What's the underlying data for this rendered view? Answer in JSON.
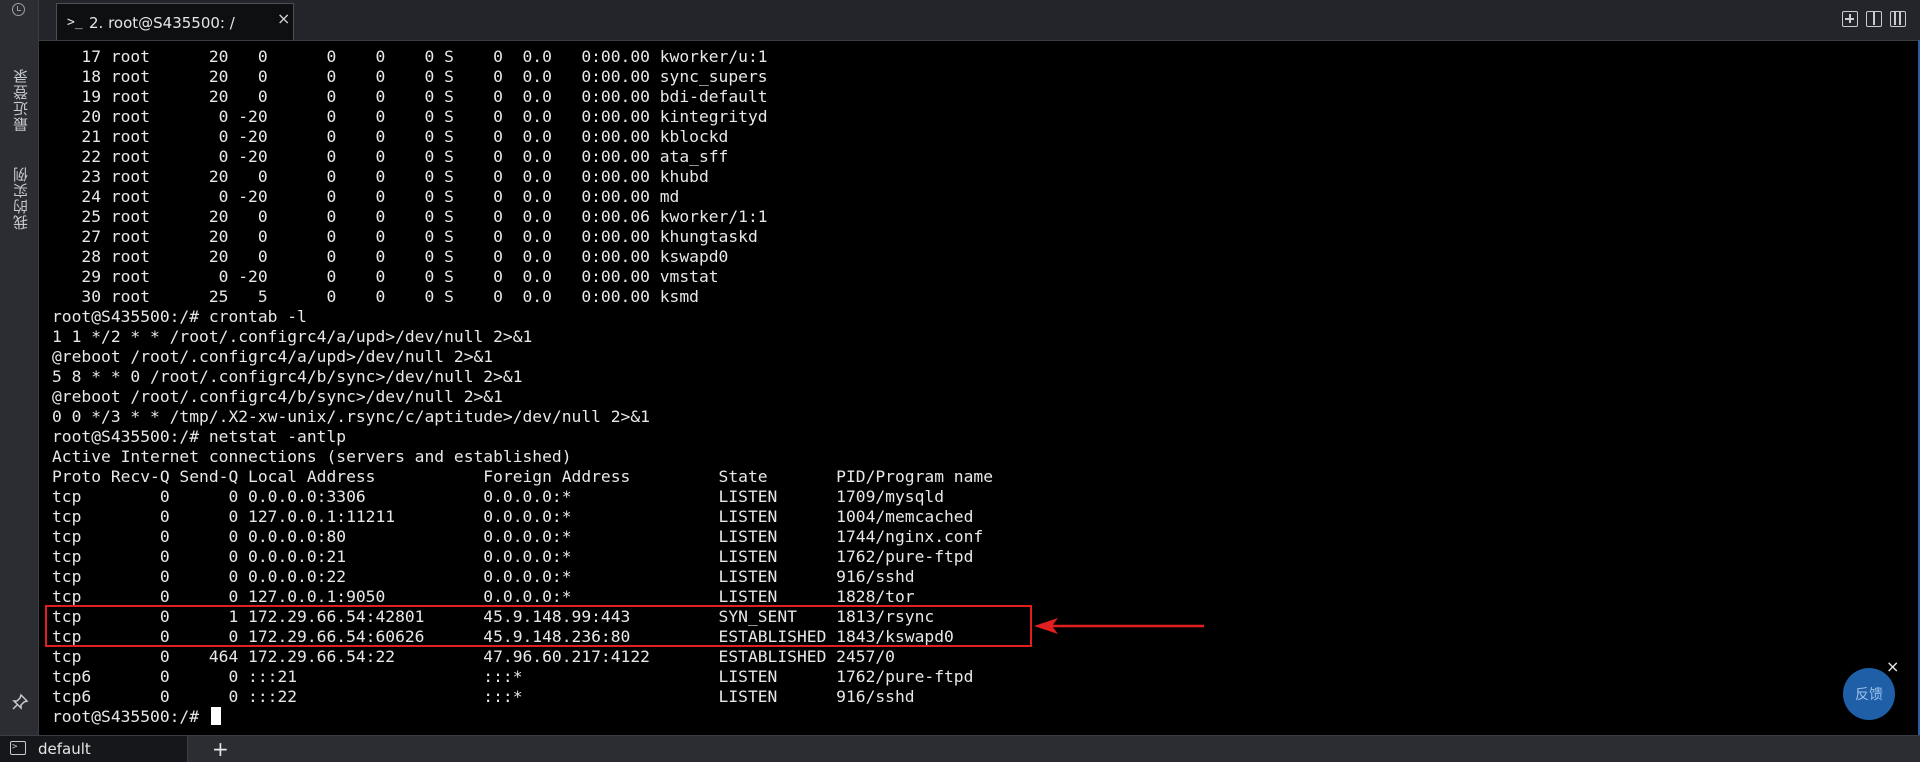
{
  "sidebar": {
    "recent_label": "最近登录",
    "mine_label": "我的实例"
  },
  "tab": {
    "prompt_icon": ">_",
    "title": "2. root@S435500: /",
    "close": "×"
  },
  "terminal": {
    "lines": [
      "   17 root      20   0      0    0    0 S    0  0.0   0:00.00 kworker/u:1",
      "   18 root      20   0      0    0    0 S    0  0.0   0:00.00 sync_supers",
      "   19 root      20   0      0    0    0 S    0  0.0   0:00.00 bdi-default",
      "   20 root       0 -20      0    0    0 S    0  0.0   0:00.00 kintegrityd",
      "   21 root       0 -20      0    0    0 S    0  0.0   0:00.00 kblockd",
      "   22 root       0 -20      0    0    0 S    0  0.0   0:00.00 ata_sff",
      "   23 root      20   0      0    0    0 S    0  0.0   0:00.00 khubd",
      "   24 root       0 -20      0    0    0 S    0  0.0   0:00.00 md",
      "   25 root      20   0      0    0    0 S    0  0.0   0:00.06 kworker/1:1",
      "   27 root      20   0      0    0    0 S    0  0.0   0:00.00 khungtaskd",
      "   28 root      20   0      0    0    0 S    0  0.0   0:00.00 kswapd0",
      "   29 root       0 -20      0    0    0 S    0  0.0   0:00.00 vmstat",
      "   30 root      25   5      0    0    0 S    0  0.0   0:00.00 ksmd",
      "root@S435500:/# crontab -l",
      "1 1 */2 * * /root/.configrc4/a/upd>/dev/null 2>&1",
      "@reboot /root/.configrc4/a/upd>/dev/null 2>&1",
      "5 8 * * 0 /root/.configrc4/b/sync>/dev/null 2>&1",
      "@reboot /root/.configrc4/b/sync>/dev/null 2>&1",
      "0 0 */3 * * /tmp/.X2-xw-unix/.rsync/c/aptitude>/dev/null 2>&1",
      "root@S435500:/# netstat -antlp",
      "Active Internet connections (servers and established)",
      "Proto Recv-Q Send-Q Local Address           Foreign Address         State       PID/Program name",
      "tcp        0      0 0.0.0.0:3306            0.0.0.0:*               LISTEN      1709/mysqld",
      "tcp        0      0 127.0.0.1:11211         0.0.0.0:*               LISTEN      1004/memcached",
      "tcp        0      0 0.0.0.0:80              0.0.0.0:*               LISTEN      1744/nginx.conf",
      "tcp        0      0 0.0.0.0:21              0.0.0.0:*               LISTEN      1762/pure-ftpd",
      "tcp        0      0 0.0.0.0:22              0.0.0.0:*               LISTEN      916/sshd",
      "tcp        0      0 127.0.0.1:9050          0.0.0.0:*               LISTEN      1828/tor",
      "tcp        0      1 172.29.66.54:42801      45.9.148.99:443         SYN_SENT    1813/rsync",
      "tcp        0      0 172.29.66.54:60626      45.9.148.236:80         ESTABLISHED 1843/kswapd0",
      "tcp        0    464 172.29.66.54:22         47.96.60.217:4122       ESTABLISHED 2457/0",
      "tcp6       0      0 :::21                   :::*                    LISTEN      1762/pure-ftpd",
      "tcp6       0      0 :::22                   :::*                    LISTEN      916/sshd"
    ],
    "prompt": "root@S435500:/# "
  },
  "feedback": {
    "label": "反馈",
    "close": "×"
  },
  "statusbar": {
    "tab_label": "default",
    "add_label": "+"
  },
  "colors": {
    "terminal_bg": "#000000",
    "terminal_text": "#e8e8e8",
    "highlight": "#e02020",
    "accent": "#1f5fa8"
  },
  "icons": [
    "history-icon",
    "instance-list-icon",
    "pin-icon",
    "new-tab-icon",
    "split-view-icon",
    "layout-icon",
    "terminal-icon"
  ]
}
